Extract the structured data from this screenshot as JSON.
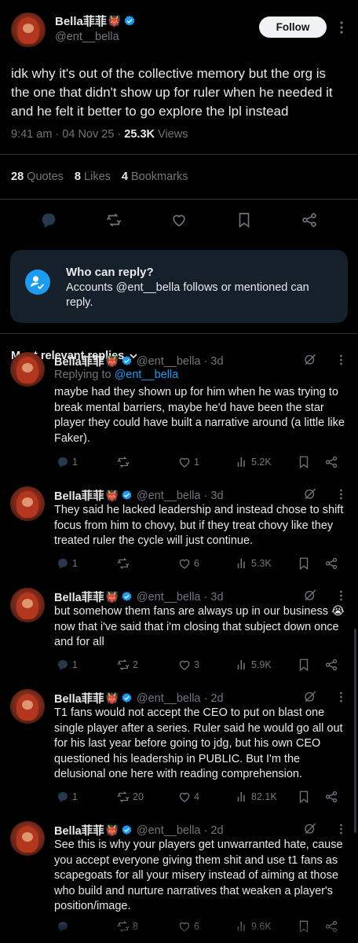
{
  "post": {
    "author_name": "Bella菲菲",
    "author_emoji": "👹",
    "author_handle": "@ent__bella",
    "follow_label": "Follow",
    "text": "idk why it's out of the collective memory but the org is the one that didn't show up for ruler when he needed it and he felt it better to go explore the lpl instead",
    "time": "9:41 am",
    "date": "04 Nov 25",
    "views_count": "25.3K",
    "views_label": "Views",
    "stats": {
      "quotes_count": "28",
      "quotes_label": "Quotes",
      "likes_count": "8",
      "likes_label": "Likes",
      "bookmarks_count": "4",
      "bookmarks_label": "Bookmarks"
    }
  },
  "who_can_reply": {
    "title": "Who can reply?",
    "body": "Accounts @ent__bella follows or mentioned can reply."
  },
  "sort_label": "Most relevant replies",
  "replies": [
    {
      "name": "Bella菲菲",
      "emoji": "👹",
      "handle": "@ent__bella",
      "age": "3d",
      "replying_prefix": "Replying to",
      "replying_handle": "@ent__bella",
      "text": "maybe had they shown up for him when he was trying to break mental barriers, maybe he'd have been the star player they could have built a narrative around (a little like Faker).",
      "replies": "1",
      "retweets": "",
      "likes": "1",
      "views": "5.2K"
    },
    {
      "name": "Bella菲菲",
      "emoji": "👹",
      "handle": "@ent__bella",
      "age": "3d",
      "text": "They said he lacked leadership and instead chose to shift focus from him to chovy, but if they treat chovy like they treated ruler the cycle will just continue.",
      "replies": "1",
      "retweets": "",
      "likes": "6",
      "views": "5.3K"
    },
    {
      "name": "Bella菲菲",
      "emoji": "👹",
      "handle": "@ent__bella",
      "age": "3d",
      "text": "but somehow them fans are always up in our business 😭 now that i've said that i'm closing that subject down once and for all",
      "replies": "1",
      "retweets": "2",
      "likes": "3",
      "views": "5.9K"
    },
    {
      "name": "Bella菲菲",
      "emoji": "👹",
      "handle": "@ent__bella",
      "age": "2d",
      "text": "T1 fans would not accept the CEO to put on blast one single player after a series. Ruler said he would go all out for his last year before going to jdg, but his own CEO questioned his leadership in PUBLIC. But I'm the delusional one here with reading comprehension.",
      "replies": "1",
      "retweets": "20",
      "likes": "4",
      "views": "82.1K"
    },
    {
      "name": "Bella菲菲",
      "emoji": "👹",
      "handle": "@ent__bella",
      "age": "2d",
      "text": "See this is why your players get unwarranted hate, cause you accept everyone giving them shit and use t1 fans as scapegoats for all your misery instead of aiming at those who build and nurture narratives that weaken a player's position/image.",
      "replies": "",
      "retweets": "8",
      "likes": "6",
      "views": "9.6K"
    }
  ],
  "colors": {
    "background": "#000000",
    "text": "#e7e9ea",
    "muted": "#71767b",
    "accent": "#1d9bf0",
    "divider": "#2f3336",
    "info_box": "#15202b"
  },
  "icons": [
    "verified-badge-icon",
    "more-icon",
    "reply-icon",
    "retweet-icon",
    "like-icon",
    "bookmark-icon",
    "share-icon",
    "views-icon",
    "grok-icon",
    "chevron-down-icon",
    "user-check-icon"
  ]
}
